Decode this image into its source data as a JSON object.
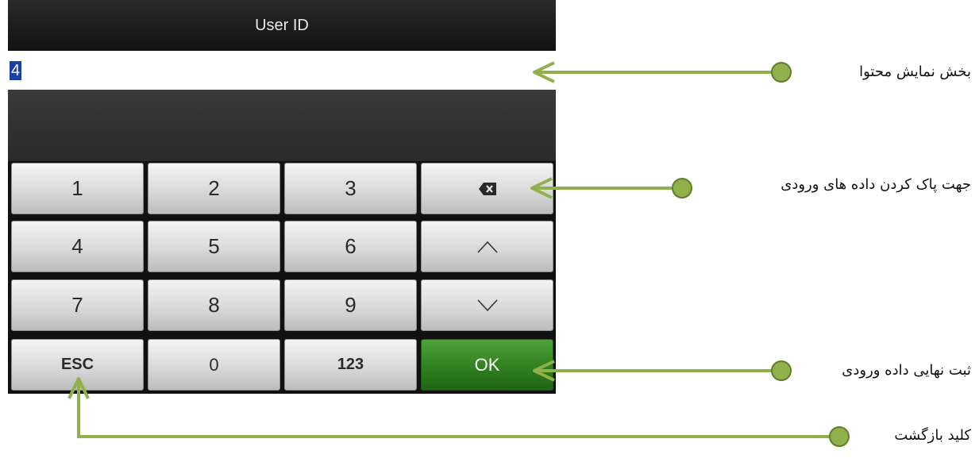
{
  "screen": {
    "title": "User ID",
    "display_value": "4"
  },
  "keypad": {
    "rows": [
      [
        "1",
        "2",
        "3",
        "backspace-icon"
      ],
      [
        "4",
        "5",
        "6",
        "chevron-up-icon"
      ],
      [
        "7",
        "8",
        "9",
        "chevron-down-icon"
      ],
      [
        "ESC",
        "0",
        "123",
        "OK"
      ]
    ],
    "labels": {
      "k1": "1",
      "k2": "2",
      "k3": "3",
      "k4": "4",
      "k5": "5",
      "k6": "6",
      "k7": "7",
      "k8": "8",
      "k9": "9",
      "esc": "ESC",
      "k0": "0",
      "mode": "123",
      "ok": "OK"
    }
  },
  "annotations": {
    "content_display": "بخش نمایش محتوا",
    "clear_input": "جهت پاک کردن داده های ورودی",
    "confirm_input": "ثبت نهایی داده ورودی",
    "back_key": "کلید بازگشت"
  },
  "colors": {
    "annotation_green": "#8fb04a",
    "ok_key_green": "#2f7d1f",
    "selection_blue": "#1a3fa8"
  }
}
